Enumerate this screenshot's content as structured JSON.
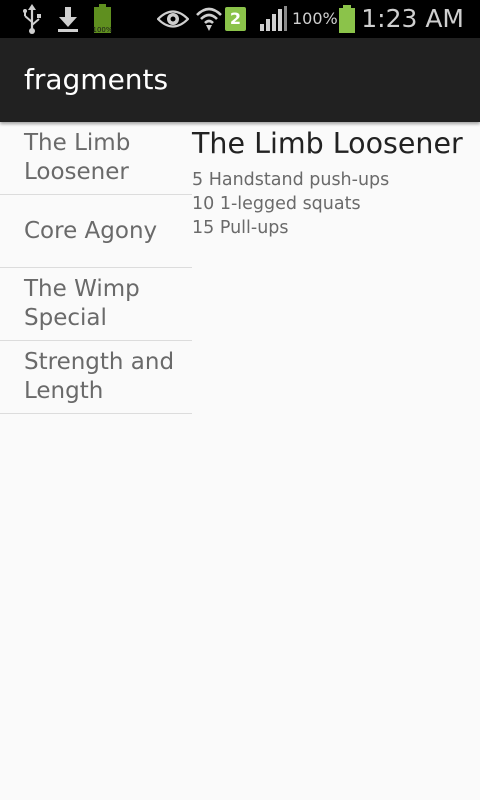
{
  "status_bar": {
    "icons": [
      "usb-icon",
      "download-icon",
      "battery-full-small-icon",
      "eye-icon",
      "wifi-icon",
      "signal-icon",
      "battery-icon"
    ],
    "notification_badge": "2",
    "signal_percent": "100%",
    "clock": "1:23 AM",
    "battery_small_label": "100%"
  },
  "action_bar": {
    "title": "fragments"
  },
  "list": {
    "items": [
      {
        "label": "The Limb Loosener"
      },
      {
        "label": "Core Agony"
      },
      {
        "label": "The Wimp Special"
      },
      {
        "label": "Strength and Length"
      }
    ]
  },
  "detail": {
    "title": "The Limb Loosener",
    "lines": [
      "5 Handstand push-ups",
      "10 1-legged squats",
      "15 Pull-ups"
    ]
  },
  "colors": {
    "status_bar_bg": "#000000",
    "action_bar_bg": "#212121",
    "content_bg": "#fafafa",
    "accent_green": "#8bc34a"
  }
}
